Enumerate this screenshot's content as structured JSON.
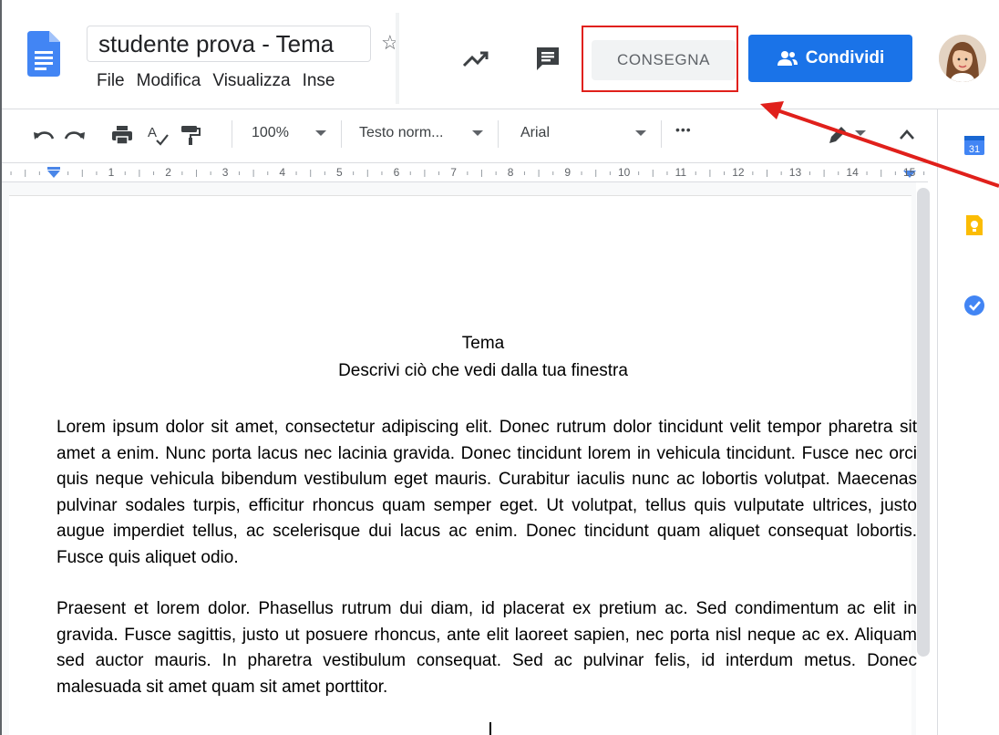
{
  "header": {
    "doc_title": "studente prova - Tema",
    "menu": [
      "File",
      "Modifica",
      "Visualizza",
      "Inse"
    ],
    "consegna_label": "CONSEGNA",
    "share_label": "Condividi"
  },
  "toolbar": {
    "zoom": "100%",
    "style": "Testo norm...",
    "font": "Arial",
    "more": "•••"
  },
  "ruler": {
    "numbers": [
      "1",
      "2",
      "3",
      "4",
      "5",
      "6",
      "7",
      "8",
      "9",
      "10",
      "11",
      "12",
      "13",
      "14",
      "15"
    ]
  },
  "document": {
    "title": "Tema",
    "subtitle": "Descrivi ciò che vedi dalla tua finestra",
    "paragraphs": [
      "Lorem ipsum dolor sit amet, consectetur adipiscing elit. Donec rutrum dolor tincidunt velit tempor pharetra sit amet a enim. Nunc porta lacus nec lacinia gravida. Donec tincidunt lorem in vehicula tincidunt. Fusce nec orci quis neque vehicula bibendum vestibulum eget mauris. Curabitur iaculis nunc ac lobortis volutpat. Maecenas pulvinar sodales turpis, efficitur rhoncus quam semper eget. Ut volutpat, tellus quis vulputate ultrices, justo augue imperdiet tellus, ac scelerisque dui lacus ac enim. Donec tincidunt quam aliquet consequat lobortis. Fusce quis aliquet odio.",
      "Praesent et lorem dolor. Phasellus rutrum dui diam, id placerat ex pretium ac. Sed condimentum ac elit in gravida. Fusce sagittis, justo ut posuere rhoncus, ante elit laoreet sapien, nec porta nisl neque ac ex. Aliquam sed auctor mauris. In pharetra vestibulum consequat. Sed ac pulvinar felis, id interdum metus. Donec malesuada sit amet quam sit amet porttitor."
    ]
  },
  "sidebar": {
    "calendar_day": "31"
  },
  "icons": {
    "app": "docs-icon",
    "star": "star-icon",
    "activity": "trending-icon",
    "comments": "comment-icon",
    "share": "people-icon",
    "undo": "undo-icon",
    "redo": "redo-icon",
    "print": "print-icon",
    "spellcheck": "spellcheck-icon",
    "paint_format": "paint-format-icon",
    "edit_mode": "pencil-icon",
    "collapse": "chevron-up-icon",
    "calendar": "calendar-icon",
    "keep": "keep-icon",
    "tasks": "tasks-icon"
  },
  "colors": {
    "share_blue": "#1a73e8",
    "highlight_red": "#e0201b",
    "docs_blue": "#4285f4",
    "keep_yellow": "#fbbc04"
  }
}
